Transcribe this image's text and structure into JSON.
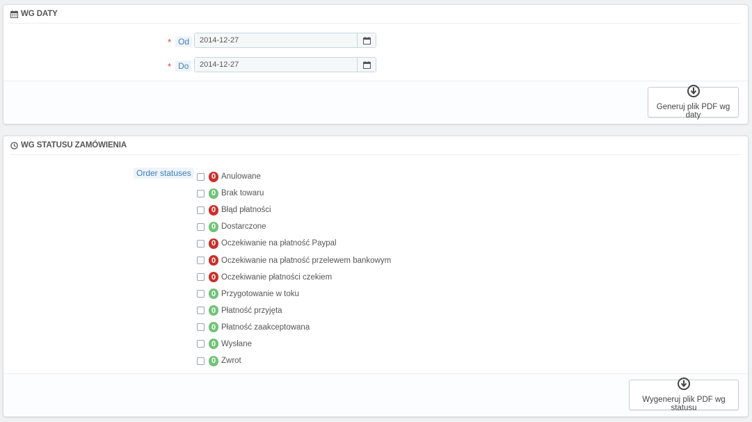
{
  "date_panel": {
    "title": "WG DATY",
    "icon": "calendar-icon",
    "from_label": "Od",
    "to_label": "Do",
    "required_mark": "*",
    "from_value": "2014-12-27",
    "to_value": "2014-12-27",
    "generate_button": "Generuj plik PDF wg daty"
  },
  "status_panel": {
    "title": "WG STATUSU ZAMÓWIENIA",
    "icon": "clock-icon",
    "statuses_label": "Order statuses",
    "statuses": [
      {
        "count": "0",
        "label": "Anulowane",
        "color": "red"
      },
      {
        "count": "0",
        "label": "Brak towaru",
        "color": "green"
      },
      {
        "count": "0",
        "label": "Błąd płatności",
        "color": "red"
      },
      {
        "count": "0",
        "label": "Dostarczone",
        "color": "green"
      },
      {
        "count": "0",
        "label": "Oczekiwanie na płatność Paypal",
        "color": "red"
      },
      {
        "count": "0",
        "label": "Oczekiwanie na płatność przelewem bankowym",
        "color": "red"
      },
      {
        "count": "0",
        "label": "Oczekiwanie płatności czekiem",
        "color": "red"
      },
      {
        "count": "0",
        "label": "Przygotowanie w toku",
        "color": "green"
      },
      {
        "count": "0",
        "label": "Płatność przyjęta",
        "color": "green"
      },
      {
        "count": "0",
        "label": "Płatność zaakceptowana",
        "color": "green"
      },
      {
        "count": "0",
        "label": "Wysłane",
        "color": "green"
      },
      {
        "count": "0",
        "label": "Zwrot",
        "color": "green"
      }
    ],
    "generate_button": "Wygeneruj plik PDF wg statusu"
  },
  "colors": {
    "badge_red": "#c9302c",
    "badge_green": "#72c279",
    "label_blue": "#3f7dba",
    "required_red": "#e03a2c"
  }
}
